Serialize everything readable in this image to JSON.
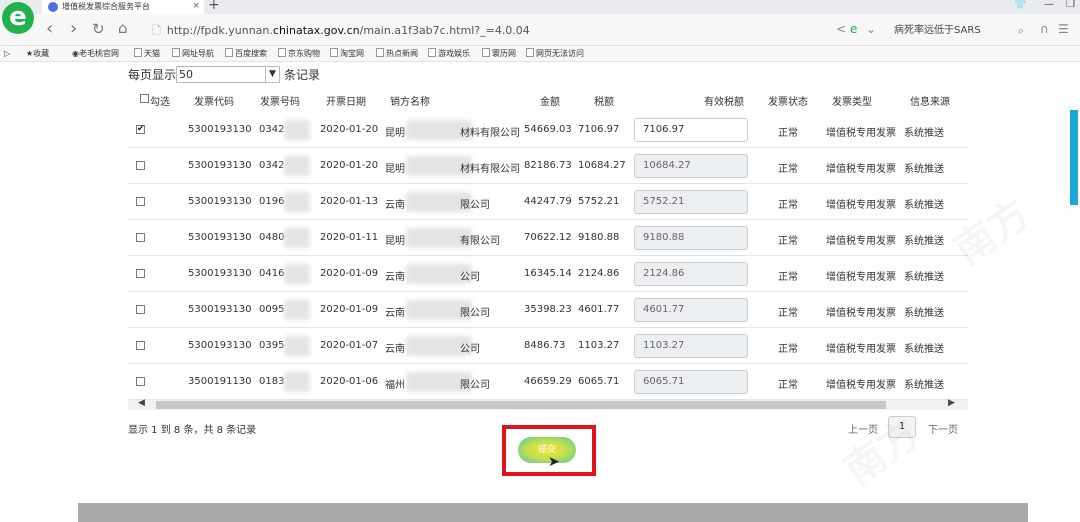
{
  "browser": {
    "tab_title": "增值税发票综合服务平台",
    "url_prefix": "http://fpdk.yunnan.",
    "url_domain": "chinatax.gov.cn",
    "url_path": "/main.a1f3ab7c.html?_=4.0.04",
    "search_text": "病死率远低于SARS",
    "bookmarks": [
      "收藏",
      "老毛桃官网",
      "天猫",
      "网址导航",
      "百度搜索",
      "京东购物",
      "淘宝网",
      "热点新闻",
      "游戏娱乐",
      "寰历网",
      "网页无法访问"
    ]
  },
  "page": {
    "per_page_label": "每页显示",
    "per_page_value": "50",
    "per_page_suffix": "条记录",
    "columns": [
      "勾选",
      "发票代码",
      "发票号码",
      "开票日期",
      "销方名称",
      "金额",
      "税额",
      "有效税额",
      "发票状态",
      "发票类型",
      "信息来源"
    ],
    "rows": [
      {
        "checked": "✔",
        "code": "5300193130",
        "number": "0342",
        "date": "2020-01-20",
        "seller_prefix": "昆明",
        "seller_suffix": "材料有限公司",
        "amount": "54669.03",
        "tax": "7106.97",
        "valid_tax": "7106.97",
        "status": "正常",
        "type": "增值税专用发票",
        "source": "系统推送"
      },
      {
        "checked": "",
        "code": "5300193130",
        "number": "0342",
        "date": "2020-01-20",
        "seller_prefix": "昆明",
        "seller_suffix": "材料有限公司",
        "amount": "82186.73",
        "tax": "10684.27",
        "valid_tax": "10684.27",
        "status": "正常",
        "type": "增值税专用发票",
        "source": "系统推送"
      },
      {
        "checked": "",
        "code": "5300193130",
        "number": "0196",
        "date": "2020-01-13",
        "seller_prefix": "云南",
        "seller_suffix": "限公司",
        "amount": "44247.79",
        "tax": "5752.21",
        "valid_tax": "5752.21",
        "status": "正常",
        "type": "增值税专用发票",
        "source": "系统推送"
      },
      {
        "checked": "",
        "code": "5300193130",
        "number": "0480",
        "date": "2020-01-11",
        "seller_prefix": "昆明",
        "seller_suffix": "有限公司",
        "amount": "70622.12",
        "tax": "9180.88",
        "valid_tax": "9180.88",
        "status": "正常",
        "type": "增值税专用发票",
        "source": "系统推送"
      },
      {
        "checked": "",
        "code": "5300193130",
        "number": "0416",
        "date": "2020-01-09",
        "seller_prefix": "云南",
        "seller_suffix": "公司",
        "amount": "16345.14",
        "tax": "2124.86",
        "valid_tax": "2124.86",
        "status": "正常",
        "type": "增值税专用发票",
        "source": "系统推送"
      },
      {
        "checked": "",
        "code": "5300193130",
        "number": "0095",
        "date": "2020-01-09",
        "seller_prefix": "云南",
        "seller_suffix": "限公司",
        "amount": "35398.23",
        "tax": "4601.77",
        "valid_tax": "4601.77",
        "status": "正常",
        "type": "增值税专用发票",
        "source": "系统推送"
      },
      {
        "checked": "",
        "code": "5300193130",
        "number": "0395",
        "date": "2020-01-07",
        "seller_prefix": "云南",
        "seller_suffix": "公司",
        "amount": "8486.73",
        "tax": "1103.27",
        "valid_tax": "1103.27",
        "status": "正常",
        "type": "增值税专用发票",
        "source": "系统推送"
      },
      {
        "checked": "",
        "code": "3500191130",
        "number": "0183",
        "date": "2020-01-06",
        "seller_prefix": "福州",
        "seller_suffix": "限公司",
        "amount": "46659.29",
        "tax": "6065.71",
        "valid_tax": "6065.71",
        "status": "正常",
        "type": "增值税专用发票",
        "source": "系统推送"
      }
    ],
    "summary": "显示 1 到 8 条，共 8 条记录",
    "prev_label": "上一页",
    "next_label": "下一页",
    "current_page": "1",
    "confirm_label": "提交"
  },
  "colors": {
    "highlight_box": "#e0141c",
    "accent_scroll": "#1aa8d6",
    "logo": "#22b14c"
  }
}
